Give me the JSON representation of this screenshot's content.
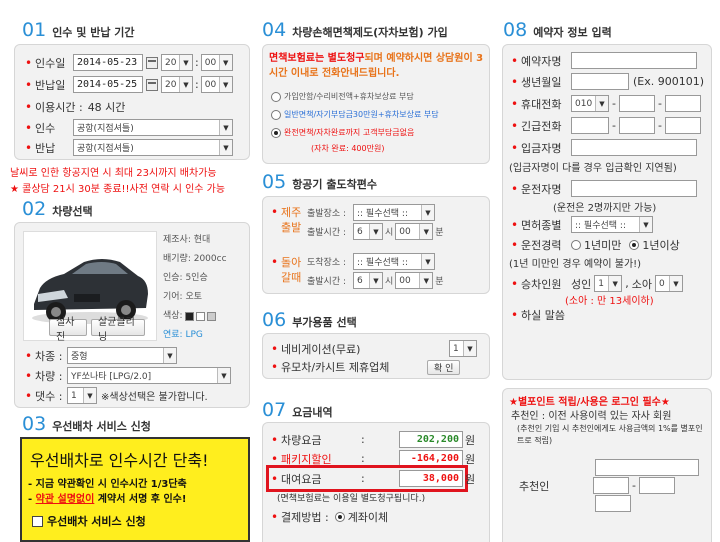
{
  "s01": {
    "num": "01",
    "title": "인수 및 반납 기간",
    "pickup": {
      "label": "인수일",
      "date": "2014-05-23",
      "hour": "20",
      "min": "00"
    },
    "return": {
      "label": "반납일",
      "date": "2014-05-25",
      "hour": "20",
      "min": "00"
    },
    "usage": {
      "label": "이용시간 :",
      "value": "48 시간"
    },
    "pickup_place": {
      "label": "인수",
      "value": "공항(지점셔틀)"
    },
    "return_place": {
      "label": "반납",
      "value": "공항(지점셔틀)"
    },
    "notice1": "날씨로 인한 항공지연 시 최대 23시까지 배차가능",
    "notice2": "★ 콜상담 21시 30분 종료!!사전 연락 시 인수 가능"
  },
  "s02": {
    "num": "02",
    "title": "차량선택",
    "specs": [
      "제조사: 현대",
      "배기량: 2000cc",
      "인승: 5인승",
      "기어: 오토",
      "색상:"
    ],
    "fuel": "연료: LPG",
    "btn_photo": "실사진",
    "btn_clean": "살균클리닝",
    "type": {
      "label": "차종 :",
      "value": "중형"
    },
    "car": {
      "label": "차량 :",
      "value": "YF쏘나타 [LPG/2.0]"
    },
    "count": {
      "label": "댓수 :",
      "value": "1",
      "note": "※색상선택은 불가합니다."
    },
    "swatch_colors": [
      "#222222",
      "#ffffff",
      "#cccccc"
    ]
  },
  "s03": {
    "num": "03",
    "title": "우선배차 서비스 신청",
    "headline": "우선배차로 인수시간 단축!",
    "line1": "- 지금 약관확인 시 인수시간 1/3단축",
    "line2_prefix": "- ",
    "line2_red": "약관 설명없이",
    "line2_rest": " 계약서 서명 후 인수!",
    "checkbox_label": "우선배차 서비스 신청"
  },
  "s04": {
    "num": "04",
    "title": "차량손해면책제도(자차보험) 가입",
    "notice_red": "면책보험료는 별도청구",
    "notice_rest": "되며 예약하시면 상담원이 3시간 이내로 전화안내드립니다.",
    "options": [
      {
        "label": "가입안함/수리비전액+휴차보상료 부담",
        "sub": ""
      },
      {
        "label": "일반면책/자기부담금30만원+휴차보상료 부담",
        "sub": ""
      },
      {
        "label": "완전면책/자차완료까지 고객부담금없음",
        "sub": "(자차 완료: 400만원)"
      }
    ]
  },
  "s05": {
    "num": "05",
    "title": "항공기 출도착편수",
    "arrive_label1": "제주",
    "arrive_label2": "출발",
    "arrive_place_label": "출발장소 :",
    "arrive_place": ":: 필수선택 ::",
    "arrive_time_label": "출발시간 :",
    "arrive_hour": "6",
    "arrive_min": "00",
    "return_label1": "돌아",
    "return_label2": "갈때",
    "return_place_label": "도착장소 :",
    "return_place": ":: 필수선택 ::",
    "return_time_label": "출발시간 :",
    "return_hour": "6",
    "return_min": "00",
    "hour_unit": "시",
    "min_unit": "분"
  },
  "s06": {
    "num": "06",
    "title": "부가용품 선택",
    "nav_label": "네비게이션(무료)",
    "nav_qty": "1",
    "cart_label": "유모차/카시트 제휴업체",
    "cart_btn": "확 인"
  },
  "s07": {
    "num": "07",
    "title": "요금내역",
    "rows": [
      {
        "label": "차량요금",
        "value": "202,200",
        "unit": "원"
      },
      {
        "label": "패키지할인",
        "value": "-164,200",
        "unit": "원"
      },
      {
        "label": "대여요금",
        "value": "38,000",
        "unit": "원"
      }
    ],
    "colon": ":",
    "note": "(면책보험료는 이용일 별도청구됩니다.)",
    "pay_label": "결제방법 :",
    "pay_value": "계좌이체"
  },
  "s08": {
    "num": "08",
    "title": "예약자 정보 입력",
    "name": "예약자명",
    "birth": "생년월일",
    "birth_hint": "(Ex. 900101)",
    "phone": "휴대전화",
    "phone_prefix": "010",
    "emergency": "긴급전화",
    "receiver": "입금자명",
    "receiver_note": "(입금자명이 다를 경우 입금확인 지연됨)",
    "driver": "운전자명",
    "driver_note": "(운전은 2명까지만 가능)",
    "license": "면허종별",
    "license_value": ":: 필수선택 ::",
    "career": "운전경력",
    "career_opt1": "1년미만",
    "career_opt2": "1년이상",
    "career_note": "(1년 미만인 경우 예약이 불가!)",
    "passengers": "승차인원",
    "adult": "성인",
    "child": "소아",
    "adult_value": "1",
    "child_value": "0",
    "child_note": "(소아 : 만 13세이하)",
    "memo": "하실 말씀"
  },
  "point": {
    "title": "★별포인트 적립/사용은 로그인 필수★",
    "desc": "추천인 : 이전 사용이력 있는 자사 회원",
    "desc2": "(추천인 기입 시 추천인에게도 사용금액의 1%를 별포인트로 적립)",
    "recommender": "추천인"
  }
}
